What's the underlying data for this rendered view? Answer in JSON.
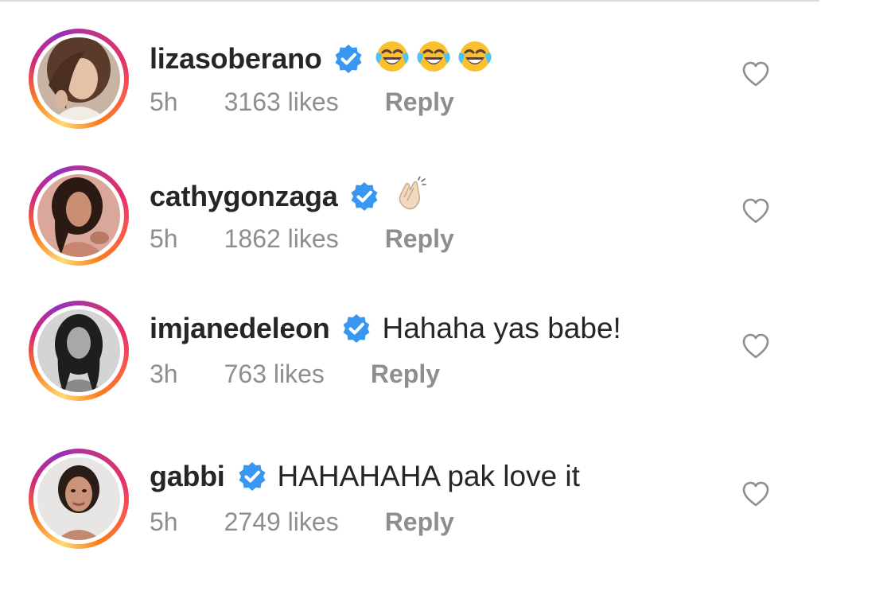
{
  "comments": [
    {
      "username": "lizasoberano",
      "verified": true,
      "text": "",
      "emoji": [
        "face-with-tears-of-joy",
        "face-with-tears-of-joy",
        "face-with-tears-of-joy"
      ],
      "time": "5h",
      "likes": "3163 likes",
      "reply_label": "Reply",
      "avatar_icon": "profile-photo-lizasoberano"
    },
    {
      "username": "cathygonzaga",
      "verified": true,
      "text": "",
      "emoji": [
        "clapping-hands-light-skin"
      ],
      "time": "5h",
      "likes": "1862 likes",
      "reply_label": "Reply",
      "avatar_icon": "profile-photo-cathygonzaga"
    },
    {
      "username": "imjanedeleon",
      "verified": true,
      "text": "Hahaha yas babe!",
      "emoji": [],
      "time": "3h",
      "likes": "763 likes",
      "reply_label": "Reply",
      "avatar_icon": "profile-photo-imjanedeleon"
    },
    {
      "username": "gabbi",
      "verified": true,
      "text": "HAHAHAHA pak love it",
      "emoji": [],
      "time": "5h",
      "likes": "2749 likes",
      "reply_label": "Reply",
      "avatar_icon": "profile-photo-gabbi"
    }
  ],
  "colors": {
    "username": "#262626",
    "meta": "#8e8e8e",
    "verified_badge": "#3897f0",
    "divider": "#dbdbdb"
  },
  "icons": {
    "verified": "verified-badge-icon",
    "like": "heart-outline-icon"
  }
}
